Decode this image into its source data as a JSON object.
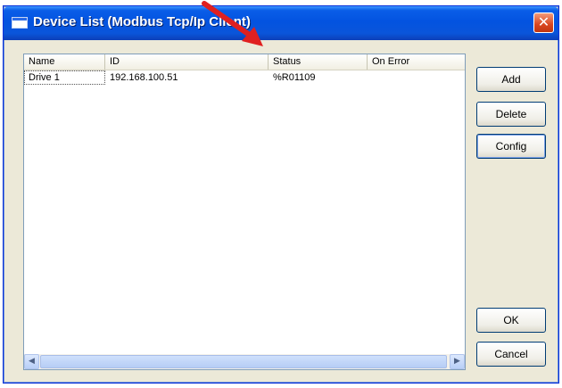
{
  "window": {
    "title": "Device List (Modbus Tcp/Ip Client)",
    "close_glyph": "✕"
  },
  "list": {
    "columns": [
      "Name",
      "ID",
      "Status",
      "On Error"
    ],
    "rows": [
      {
        "name": "Drive 1",
        "id": "192.168.100.51",
        "status": "%R01109",
        "on_error": ""
      }
    ]
  },
  "scrollbar": {
    "left_glyph": "◀",
    "right_glyph": "▶"
  },
  "buttons": {
    "add": "Add",
    "delete": "Delete",
    "config": "Config",
    "ok": "OK",
    "cancel": "Cancel"
  },
  "colors": {
    "annotation_arrow": "#e02020",
    "titlebar": "#0353e0"
  }
}
